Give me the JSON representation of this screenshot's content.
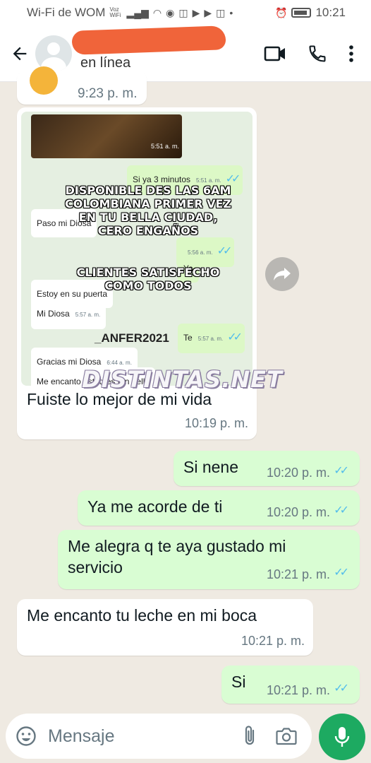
{
  "status_bar": {
    "network": "Wi-Fi de WOM",
    "volte": "Voz WiFi",
    "time": "10:21"
  },
  "header": {
    "status": "en línea"
  },
  "messages": [
    {
      "id": "m0",
      "dir": "in",
      "time": "9:23 p. m."
    },
    {
      "id": "m1",
      "dir": "in",
      "type": "image",
      "caption": "Fuiste lo mejor de mi vida",
      "time": "10:19 p. m.",
      "screenshot": {
        "img_time": "5:51 a. m.",
        "bubbles": [
          {
            "dir": "out",
            "text": "Si ya 3 minutos",
            "time": "5:51 a. m."
          },
          {
            "dir": "in",
            "text": "Paso mi Diosa",
            "time": ""
          },
          {
            "dir": "out",
            "text": "",
            "time": "5:56 a. m."
          },
          {
            "dir": "out",
            "text": "Ya",
            "time": ""
          },
          {
            "dir": "in",
            "text": "Estoy en su puerta",
            "time": ""
          },
          {
            "dir": "in",
            "text": "Mi Diosa",
            "time": "5:57 a. m."
          },
          {
            "dir": "out",
            "text": "Te",
            "time": "5:57 a. m."
          },
          {
            "dir": "in",
            "text": "Gracias mi Diosa",
            "time": "6:44 a. m."
          },
          {
            "dir": "in",
            "text": "Me encanto usted es tan bella",
            "time": ""
          }
        ],
        "overlay1": "DISPONIBLE DES LAS 6AM COLOMBIANA PRIMER VEZ EN TU BELLA CIUDAD, CERO ENGAÑOS",
        "overlay2": "CLIENTES SATISFECHO COMO TODOS",
        "handle": "_ANFER2021"
      }
    },
    {
      "id": "m2",
      "dir": "out",
      "text": "Si nene",
      "time": "10:20 p. m."
    },
    {
      "id": "m3",
      "dir": "out",
      "text": "Ya me acorde de ti",
      "time": "10:20 p. m."
    },
    {
      "id": "m4",
      "dir": "out",
      "text": "Me alegra q te aya gustado mi servicio",
      "time": "10:21 p. m."
    },
    {
      "id": "m5",
      "dir": "in",
      "text": "Me encanto tu leche en mi boca",
      "time": "10:21 p. m."
    },
    {
      "id": "m6",
      "dir": "out",
      "text": "Si",
      "time": "10:21 p. m."
    }
  ],
  "watermark": "DISTINTAS.NET",
  "composer": {
    "placeholder": "Mensaje"
  },
  "colors": {
    "chat_bg": "#efeae2",
    "incoming": "#ffffff",
    "outgoing": "#d9fdd3",
    "read_ticks": "#53bdeb",
    "mic": "#1daa61",
    "redaction": "#f0643a"
  },
  "icons": [
    "back-arrow-icon",
    "video-call-icon",
    "voice-call-icon",
    "more-options-icon",
    "forward-icon",
    "emoji-icon",
    "attach-icon",
    "camera-icon",
    "mic-icon"
  ]
}
